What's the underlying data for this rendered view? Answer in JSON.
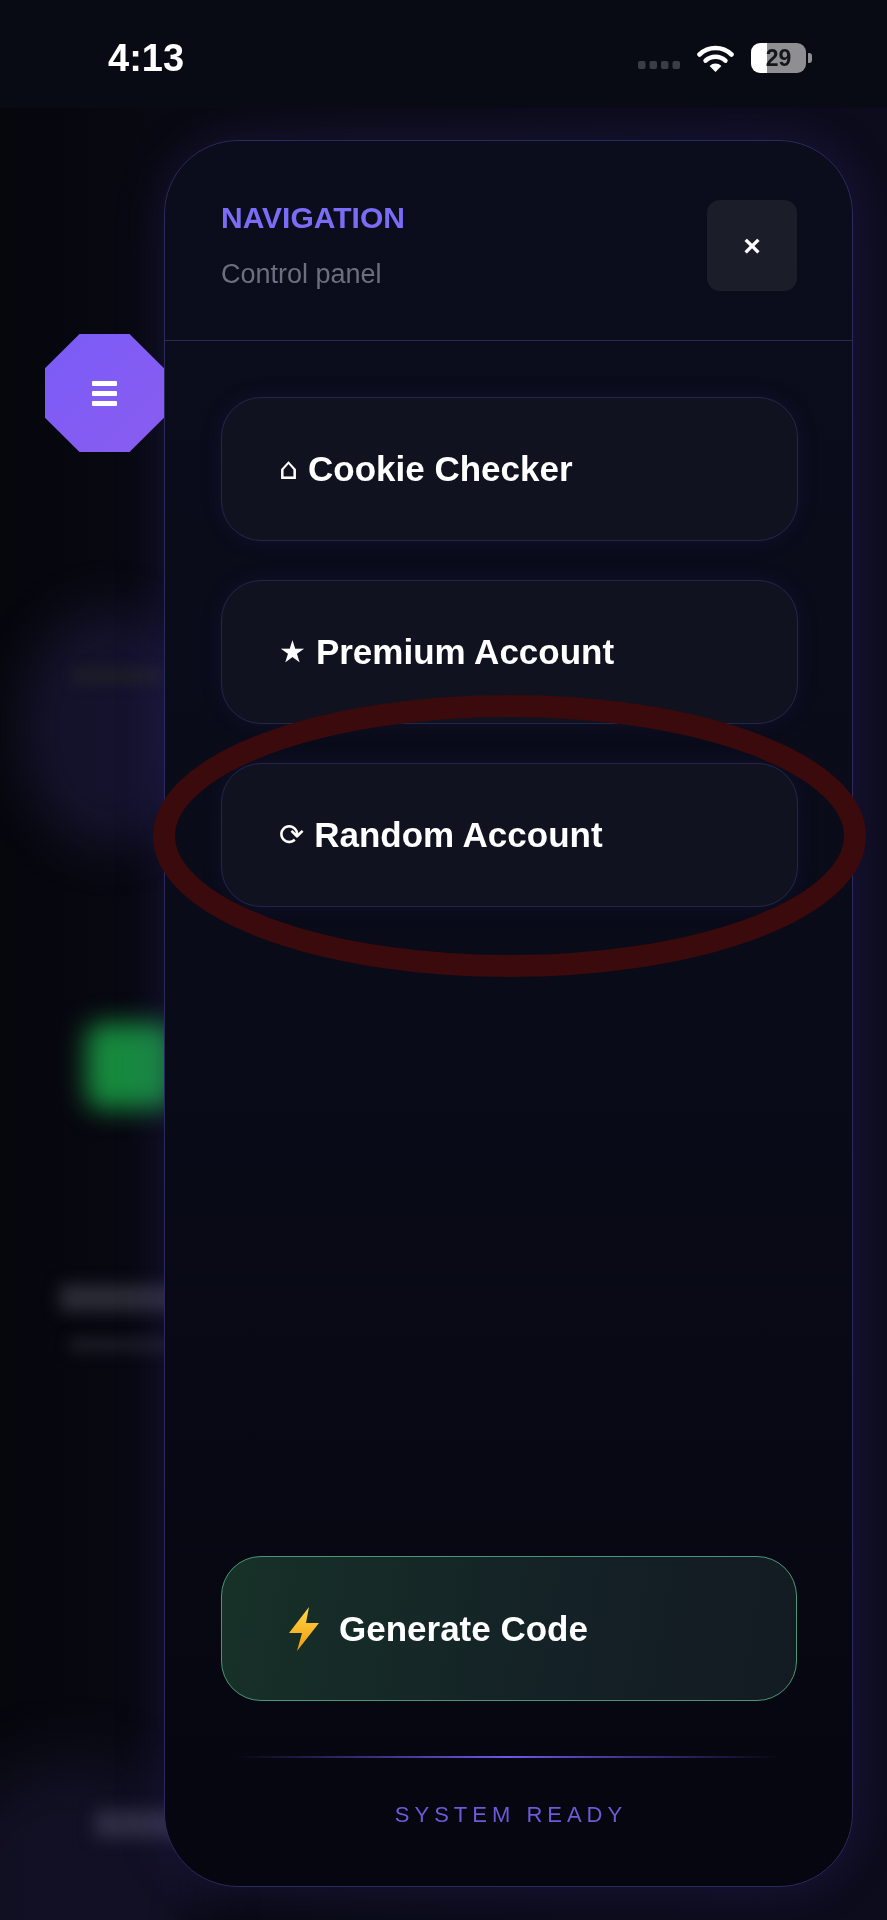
{
  "status_bar": {
    "time": "4:13",
    "battery": "29"
  },
  "panel": {
    "title": "NAVIGATION",
    "subtitle": "Control panel",
    "close_button": "×",
    "items": [
      {
        "icon": "⌂",
        "label": "Cookie Checker",
        "highlighted": false
      },
      {
        "icon": "★",
        "label": "Premium Account",
        "highlighted": false
      },
      {
        "icon": "⟳",
        "label": "Random Account",
        "highlighted": true
      }
    ],
    "action_button": {
      "label": "Generate Code"
    },
    "status": "SYSTEM READY"
  }
}
